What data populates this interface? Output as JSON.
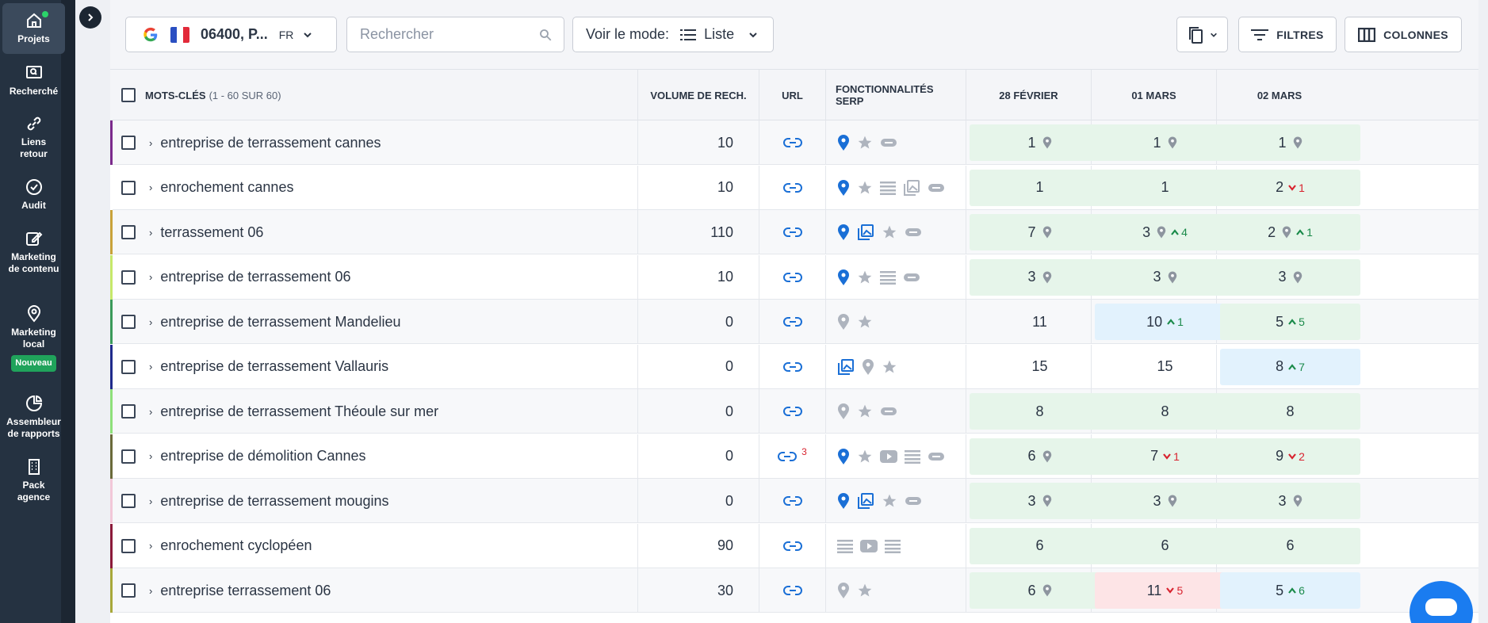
{
  "sidebar": {
    "items": [
      {
        "label": "Projets",
        "icon": "home-icon",
        "active": true
      },
      {
        "label": "Recherché",
        "icon": "search-screen-icon"
      },
      {
        "label": "Liens retour",
        "icon": "link-icon"
      },
      {
        "label": "Audit",
        "icon": "check-circle-icon"
      },
      {
        "label": "Marketing de contenu",
        "icon": "edit-icon"
      },
      {
        "label": "Marketing local",
        "icon": "location-pin-icon",
        "badge": "Nouveau"
      },
      {
        "label": "Assembleur de rapports",
        "icon": "pie-chart-icon"
      },
      {
        "label": "Pack agence",
        "icon": "building-icon"
      }
    ]
  },
  "toolbar": {
    "location": "06400, P...",
    "lang": "FR",
    "search_placeholder": "Rechercher",
    "view_label": "Voir le mode:",
    "view_value": "Liste",
    "filters_label": "FILTRES",
    "columns_label": "COLONNES"
  },
  "table": {
    "headers": {
      "keywords": "MOTS-CLÉS",
      "keywords_count": "(1 - 60 SUR 60)",
      "volume": "VOLUME DE RECH.",
      "url": "URL",
      "serp": "FONCTIONNALITÉS SERP",
      "dates": [
        "28 FÉVRIER",
        "01 MARS",
        "02 MARS"
      ]
    },
    "rows": [
      {
        "keyword": "entreprise de terrassement cannes",
        "volume": "10",
        "bar": "#7b2a8c",
        "serp": [
          "pin-blue",
          "star",
          "tag"
        ],
        "pos": [
          {
            "v": "1",
            "bg": "green",
            "pin": true
          },
          {
            "v": "1",
            "bg": "green",
            "pin": true
          },
          {
            "v": "1",
            "bg": "green",
            "pin": true
          }
        ]
      },
      {
        "keyword": "enrochement cannes",
        "volume": "10",
        "bar": "#ffffff",
        "serp": [
          "pin-blue",
          "star",
          "list",
          "image-grey",
          "tag"
        ],
        "pos": [
          {
            "v": "1",
            "bg": "green"
          },
          {
            "v": "1",
            "bg": "green"
          },
          {
            "v": "2",
            "bg": "green",
            "delta": "1",
            "dir": "down"
          }
        ]
      },
      {
        "keyword": "terrassement 06",
        "volume": "110",
        "bar": "#c8a23a",
        "serp": [
          "pin-blue",
          "image-blue",
          "star",
          "tag"
        ],
        "pos": [
          {
            "v": "7",
            "bg": "green",
            "pin": true
          },
          {
            "v": "3",
            "bg": "green",
            "pin": true,
            "delta": "4",
            "dir": "up"
          },
          {
            "v": "2",
            "bg": "green",
            "pin": true,
            "delta": "1",
            "dir": "up"
          }
        ]
      },
      {
        "keyword": "entreprise de terrassement 06",
        "volume": "10",
        "bar": "#c6e86a",
        "serp": [
          "pin-blue",
          "star",
          "list",
          "tag"
        ],
        "pos": [
          {
            "v": "3",
            "bg": "green",
            "pin": true
          },
          {
            "v": "3",
            "bg": "green",
            "pin": true
          },
          {
            "v": "3",
            "bg": "green",
            "pin": true
          }
        ]
      },
      {
        "keyword": "entreprise de terrassement Mandelieu",
        "volume": "0",
        "bar": "#3a9a5a",
        "serp": [
          "pin-grey",
          "star"
        ],
        "pos": [
          {
            "v": "11"
          },
          {
            "v": "10",
            "bg": "blue",
            "delta": "1",
            "dir": "up"
          },
          {
            "v": "5",
            "bg": "green",
            "delta": "5",
            "dir": "up"
          }
        ]
      },
      {
        "keyword": "entreprise de terrassement Vallauris",
        "volume": "0",
        "bar": "#1f2a8c",
        "serp": [
          "image-blue",
          "pin-grey",
          "star"
        ],
        "pos": [
          {
            "v": "15"
          },
          {
            "v": "15"
          },
          {
            "v": "8",
            "bg": "blue",
            "delta": "7",
            "dir": "up"
          }
        ]
      },
      {
        "keyword": "entreprise de terrassement Théoule sur mer",
        "volume": "0",
        "bar": "#8ee07a",
        "serp": [
          "pin-grey",
          "star",
          "tag"
        ],
        "pos": [
          {
            "v": "8",
            "bg": "green"
          },
          {
            "v": "8",
            "bg": "green"
          },
          {
            "v": "8",
            "bg": "green"
          }
        ]
      },
      {
        "keyword": "entreprise de démolition Cannes",
        "volume": "0",
        "bar": "#6a6a3a",
        "url_count": "3",
        "serp": [
          "pin-blue",
          "star",
          "video",
          "list",
          "tag"
        ],
        "pos": [
          {
            "v": "6",
            "bg": "green",
            "pin": true
          },
          {
            "v": "7",
            "bg": "green",
            "delta": "1",
            "dir": "down"
          },
          {
            "v": "9",
            "bg": "green",
            "delta": "2",
            "dir": "down"
          }
        ]
      },
      {
        "keyword": "entreprise de terrassement mougins",
        "volume": "0",
        "bar": "#f2c8d8",
        "serp": [
          "pin-blue",
          "image-blue",
          "star",
          "tag"
        ],
        "pos": [
          {
            "v": "3",
            "bg": "green",
            "pin": true
          },
          {
            "v": "3",
            "bg": "green",
            "pin": true
          },
          {
            "v": "3",
            "bg": "green",
            "pin": true
          }
        ]
      },
      {
        "keyword": "enrochement cyclopéen",
        "volume": "90",
        "bar": "#8c1a3a",
        "serp": [
          "list",
          "video",
          "list"
        ],
        "pos": [
          {
            "v": "6",
            "bg": "green"
          },
          {
            "v": "6",
            "bg": "green"
          },
          {
            "v": "6",
            "bg": "green"
          }
        ]
      },
      {
        "keyword": "entreprise terrassement 06",
        "volume": "30",
        "bar": "#a8a83a",
        "serp": [
          "pin-grey",
          "star"
        ],
        "pos": [
          {
            "v": "6",
            "bg": "green",
            "pin": true
          },
          {
            "v": "11",
            "bg": "red",
            "delta": "5",
            "dir": "down"
          },
          {
            "v": "5",
            "bg": "blue",
            "delta": "6",
            "dir": "up"
          }
        ]
      }
    ]
  },
  "colors": {
    "sidebar_bg": "#253241",
    "link_blue": "#1a6fd6",
    "green_cell": "#e6f5ea",
    "blue_cell": "#e2f2fd",
    "red_cell": "#fde4e6"
  }
}
